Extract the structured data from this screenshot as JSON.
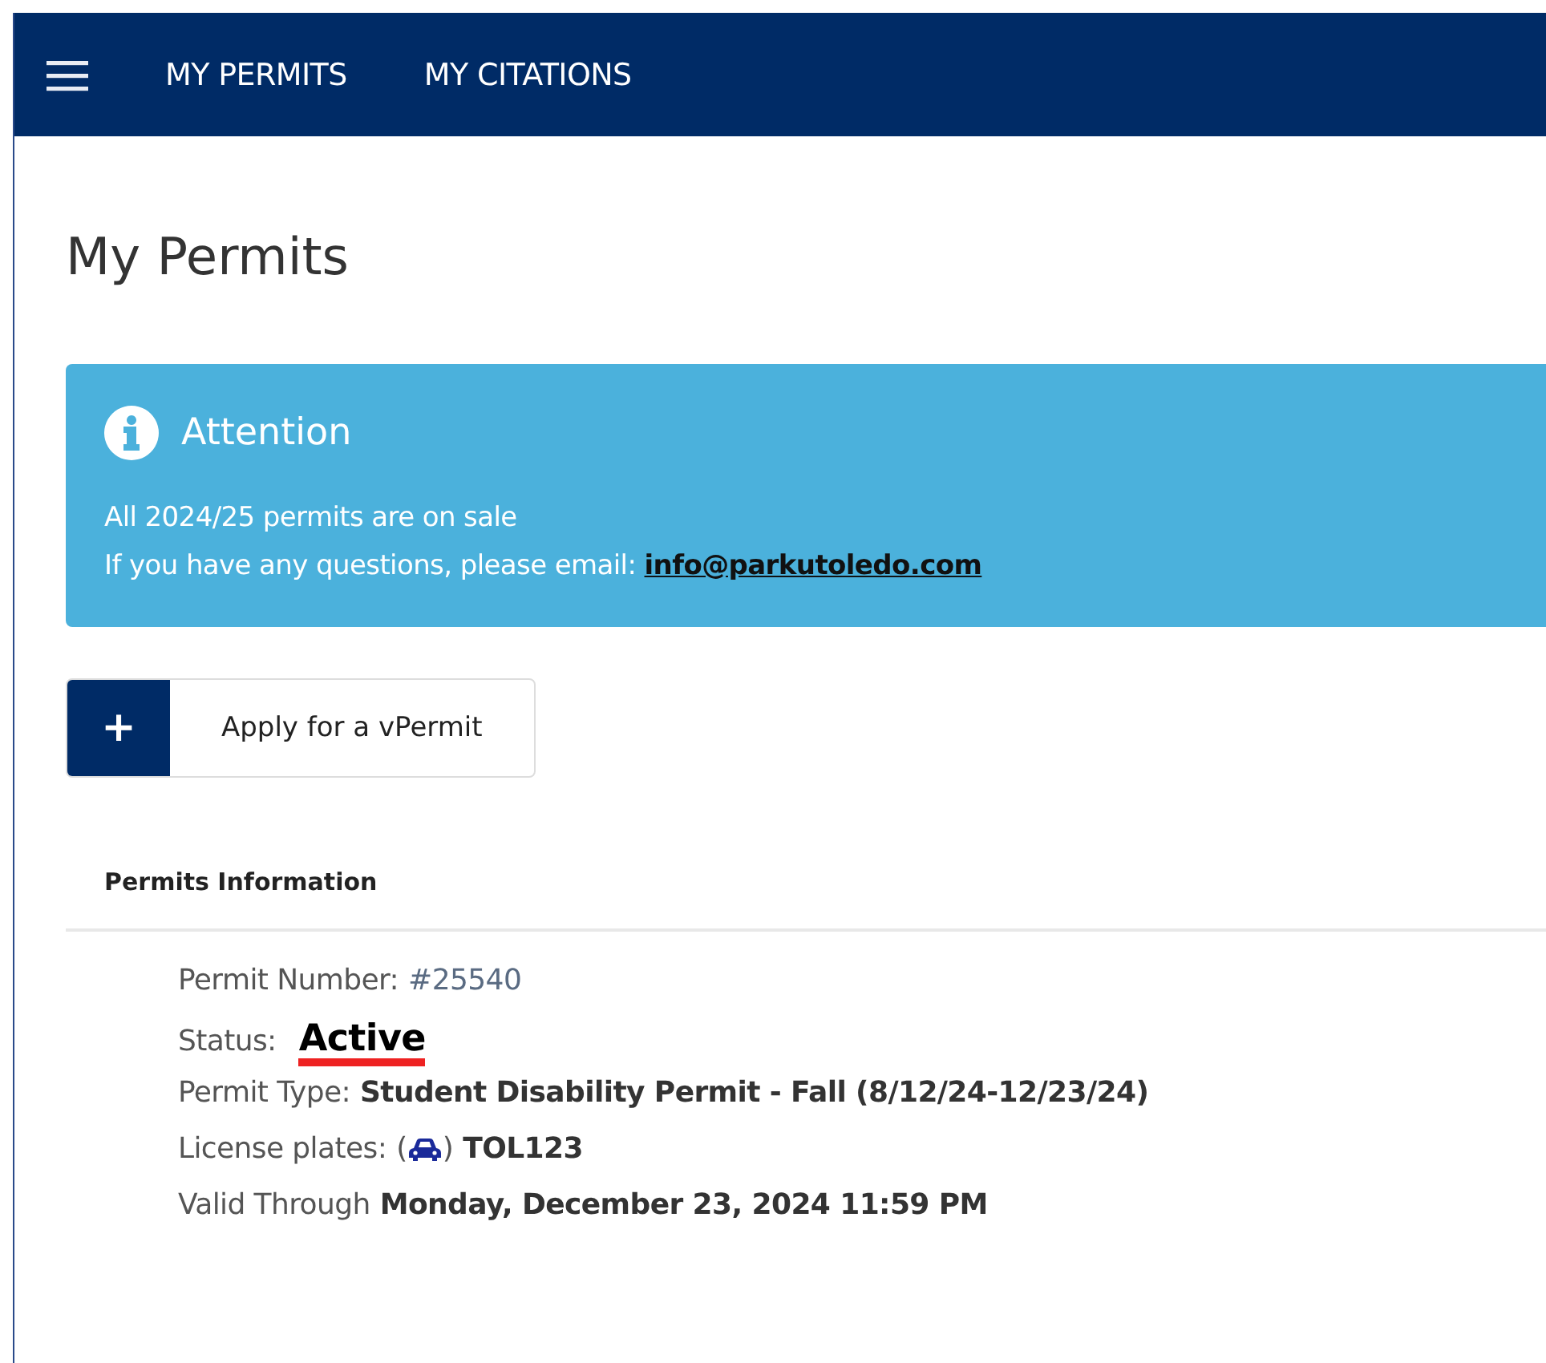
{
  "nav": {
    "items": [
      {
        "label": "MY PERMITS"
      },
      {
        "label": "MY CITATIONS"
      }
    ]
  },
  "page_title": "My Permits",
  "alert": {
    "title": "Attention",
    "lines": [
      {
        "text": "All 2024/25 permits are on sale"
      },
      {
        "text": "If you have any questions, please email:",
        "link": "info@parkutoledo.com"
      }
    ]
  },
  "apply_button": {
    "icon": "+",
    "label": "Apply for a vPermit"
  },
  "section_title": "Permits Information",
  "fields": [
    {
      "kind": "number",
      "label": "Permit Number:",
      "value": "#25540"
    },
    {
      "kind": "status",
      "label": "Status:",
      "value": "Active"
    },
    {
      "kind": "bold",
      "label": "Permit Type:",
      "value": "Student Disability Permit - Fall (8/12/24-12/23/24)"
    },
    {
      "kind": "plate",
      "label": "License plates:",
      "open": "(",
      "close": ")",
      "value": "TOL123"
    },
    {
      "kind": "bold",
      "label": "Valid Through",
      "value": "Monday, December 23, 2024 11:59 PM"
    }
  ]
}
